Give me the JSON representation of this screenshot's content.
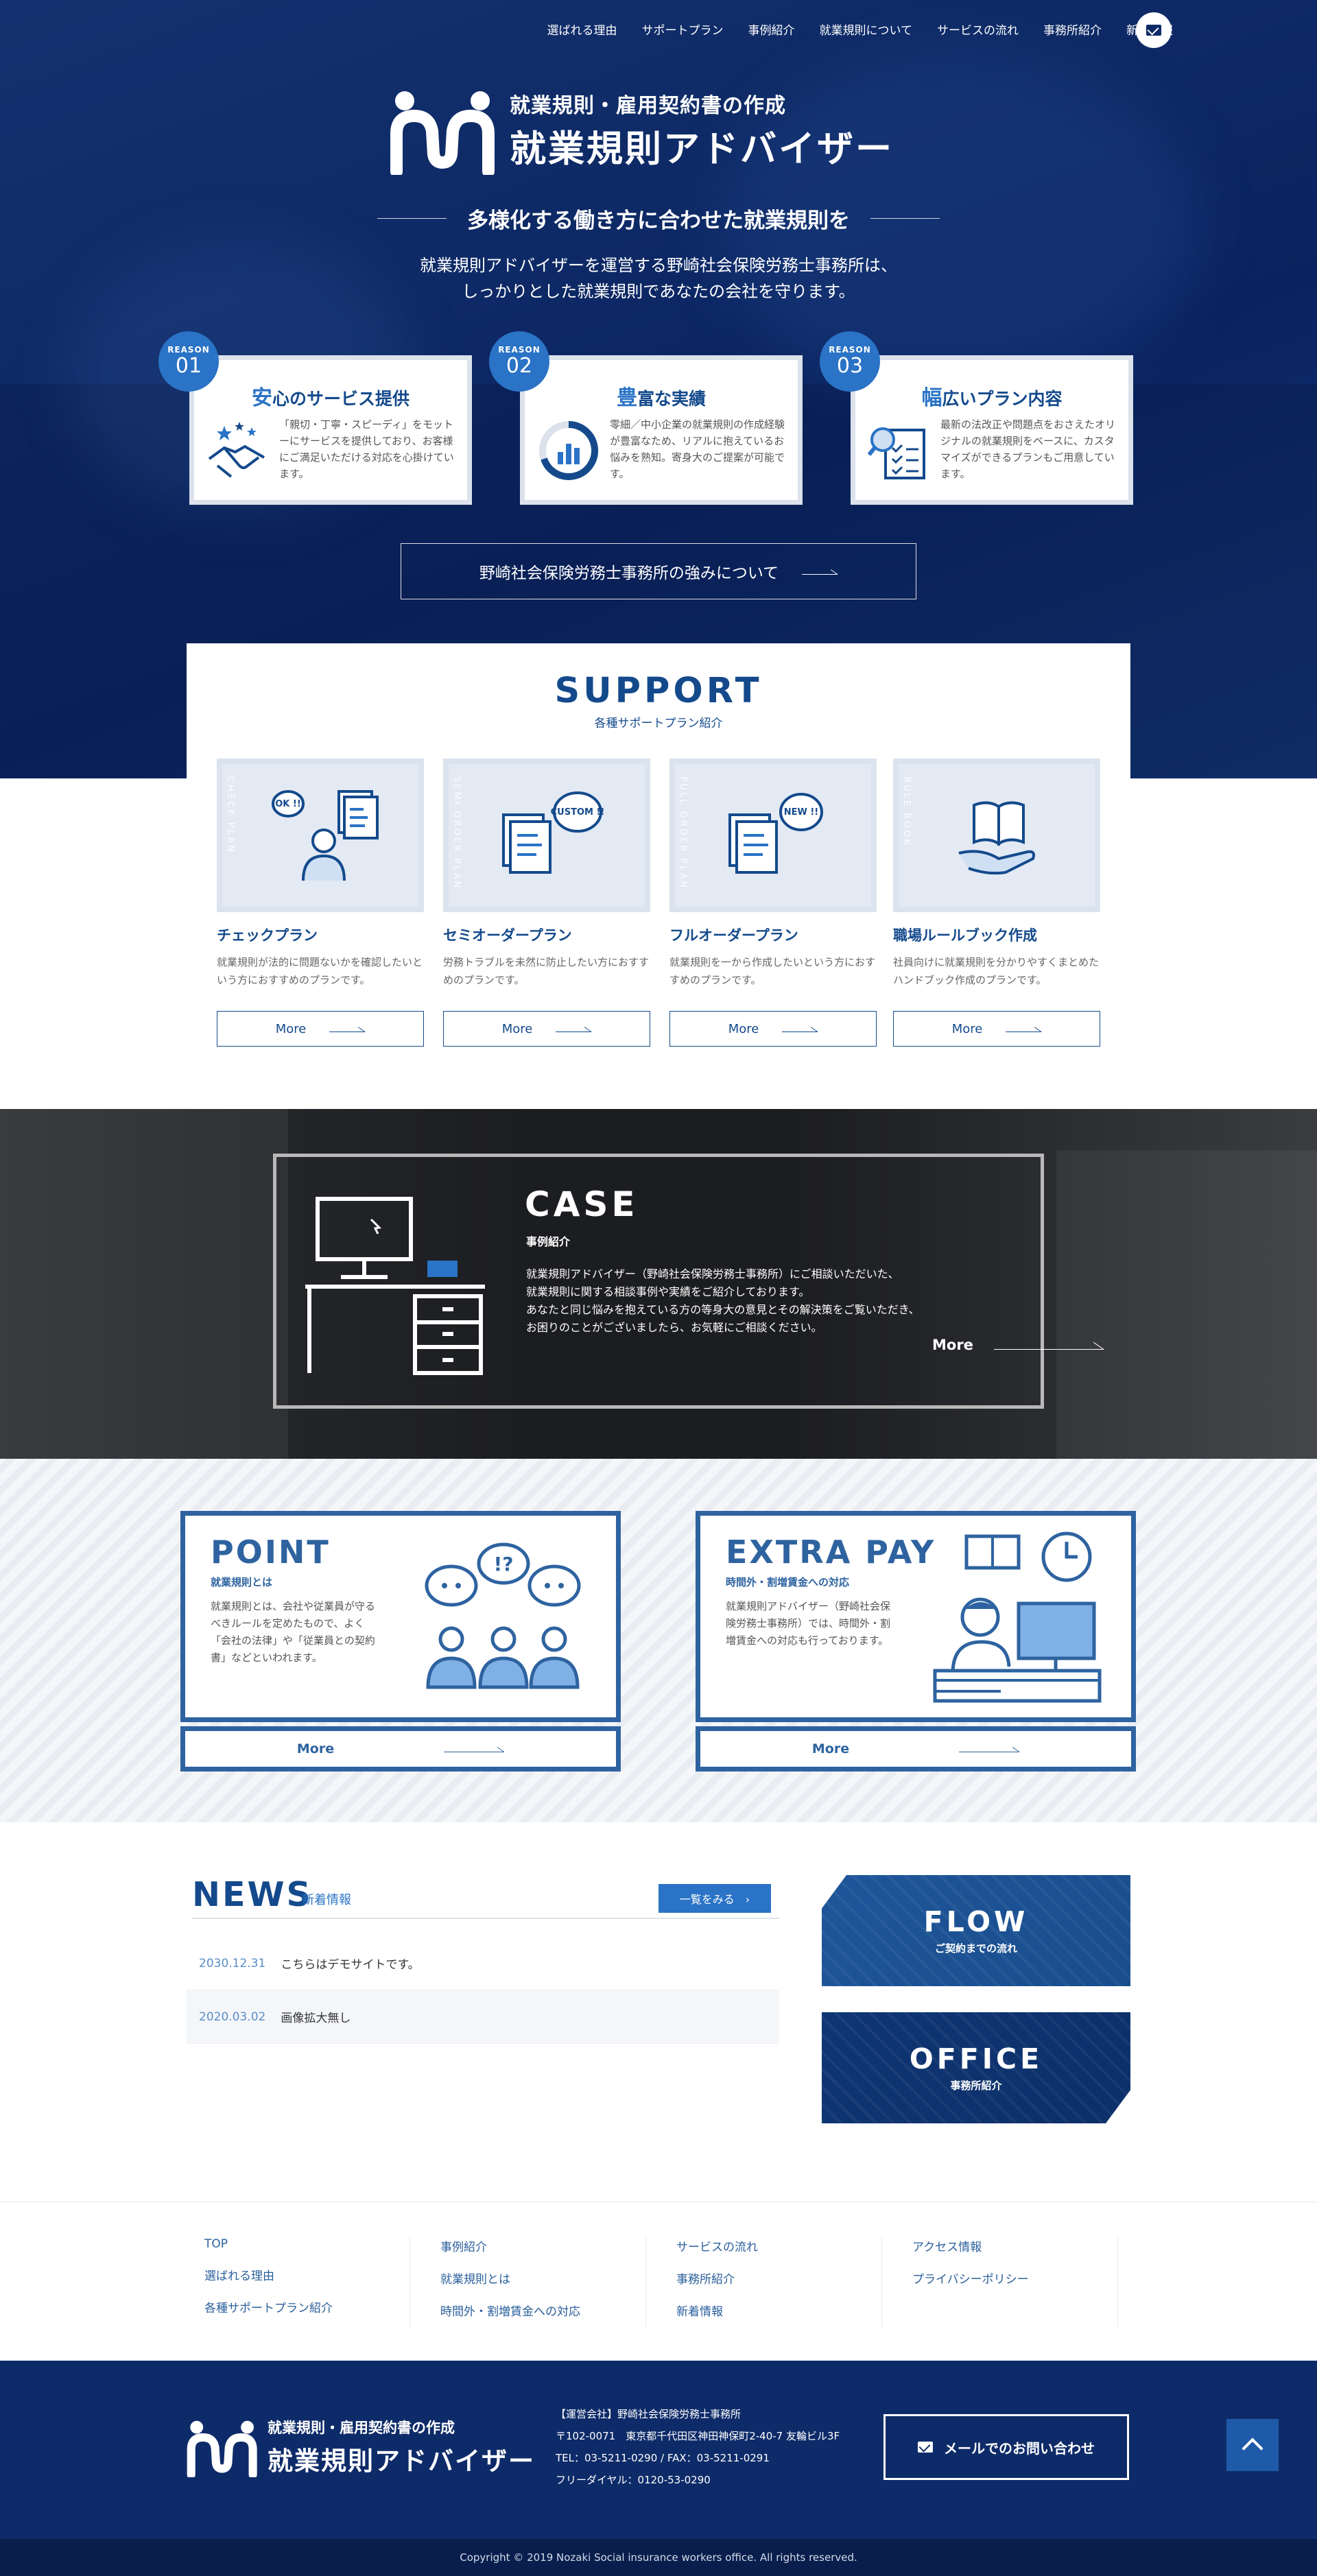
{
  "nav": {
    "items": [
      "選ばれる理由",
      "サポートプラン",
      "事例紹介",
      "就業規則について",
      "サービスの流れ",
      "事務所紹介",
      "新着情報"
    ]
  },
  "brand": {
    "sub": "就業規則・雇用契約書の作成",
    "main": "就業規則アドバイザー"
  },
  "hero": {
    "tagline": "多様化する働き方に合わせた就業規則を",
    "intro_line1": "就業規則アドバイザーを運営する野崎社会保険労務士事務所は、",
    "intro_line2": "しっかりとした就業規則であなたの会社を守ります。",
    "strength_button": "野崎社会保険労務士事務所の強みについて"
  },
  "reasons": [
    {
      "badge_top": "REASON",
      "num": "01",
      "title_first": "安",
      "title_rest": "心のサービス提供",
      "text": "「親切・丁寧・スピーディ」をモットーにサービスを提供しており、お客様にご満足いただける対応を心掛けています。",
      "icon": "handshake-icon"
    },
    {
      "badge_top": "REASON",
      "num": "02",
      "title_first": "豊",
      "title_rest": "富な実績",
      "text": "零細／中小企業の就業規則の作成経験が豊富なため、リアルに抱えているお悩みを熟知。寄身大のご提案が可能です。",
      "icon": "chart-icon"
    },
    {
      "badge_top": "REASON",
      "num": "03",
      "title_first": "幅",
      "title_rest": "広いプラン内容",
      "text": "最新の法改正や問題点をおさえたオリジナルの就業規則をベースに、カスタマイズができるプランもご用意しています。",
      "icon": "checklist-icon"
    }
  ],
  "support": {
    "title": "SUPPORT",
    "subtitle": "各種サポートプラン紹介",
    "plans": [
      {
        "vlabel": "CHECK PLAN",
        "name": "チェックプラン",
        "desc": "就業規則が法的に問題ないかを確認したいという方におすすめのプランです。",
        "more": "More",
        "bubble": "OK !!"
      },
      {
        "vlabel": "SEMI ORDER PLAN",
        "name": "セミオーダープラン",
        "desc": "労務トラブルを未然に防止したい方におすすめのプランです。",
        "more": "More",
        "bubble": "CUSTOM !!"
      },
      {
        "vlabel": "FULL ORDER PLAN",
        "name": "フルオーダープラン",
        "desc": "就業規則を一から作成したいという方におすすめのプランです。",
        "more": "More",
        "bubble": "NEW !!"
      },
      {
        "vlabel": "RULE BOOK",
        "name": "職場ルールブック作成",
        "desc": "社員向けに就業規則を分かりやすくまとめたハンドブック作成のプランです。",
        "more": "More",
        "bubble": ""
      }
    ]
  },
  "case": {
    "title": "CASE",
    "subtitle": "事例紹介",
    "text": [
      "就業規則アドバイザー（野崎社会保険労務士事務所）にご相談いただいた、",
      "就業規則に関する相談事例や実績をご紹介しております。",
      "あなたと同じ悩みを抱えている方の等身大の意見とその解決策をご覧いただき、",
      "お困りのことがございましたら、お気軽にご相談ください。"
    ],
    "more": "More"
  },
  "point": {
    "title": "POINT",
    "subtitle": "就業規則とは",
    "text": "就業規則とは、会社や従業員が守るべきルールを定めたもので、よく「会社の法律」や「従業員との契約書」などといわれます。",
    "more": "More"
  },
  "extra": {
    "title": "EXTRA PAY",
    "subtitle": "時間外・割増賃金への対応",
    "text": "就業規則アドバイザー（野崎社会保険労務士事務所）では、時間外・割増賃金への対応も行っております。",
    "more": "More"
  },
  "news": {
    "title": "NEWS",
    "subtitle": "新着情報",
    "all_button": "一覧をみる　›",
    "items": [
      {
        "date": "2030.12.31",
        "title": "こちらはデモサイトです。"
      },
      {
        "date": "2020.03.02",
        "title": "画像拡大無し"
      }
    ]
  },
  "side": {
    "flow_title": "FLOW",
    "flow_sub": "ご契約までの流れ",
    "office_title": "OFFICE",
    "office_sub": "事務所紹介"
  },
  "footer_links": [
    [
      "TOP",
      "選ばれる理由",
      "各種サポートプラン紹介"
    ],
    [
      "事例紹介",
      "就業規則とは",
      "時間外・割増賃金への対応"
    ],
    [
      "サービスの流れ",
      "事務所紹介",
      "新着情報"
    ],
    [
      "アクセス情報",
      "プライバシーポリシー"
    ]
  ],
  "footer": {
    "company": "【運営会社】野崎社会保険労務士事務所",
    "address": "〒102-0071　東京都千代田区神田神保町2-40-7 友輪ビル3F",
    "tel": "TEL：03-5211-0290 / FAX：03-5211-0291",
    "free": "フリーダイヤル：0120-53-0290",
    "contact": "メールでのお問い合わせ",
    "copyright": "Copyright © 2019 Nozaki Social insurance workers office. All rights reserved."
  },
  "colors": {
    "navy": "#0e2b69",
    "accent": "#2a73c6",
    "brand": "#144a8c"
  }
}
